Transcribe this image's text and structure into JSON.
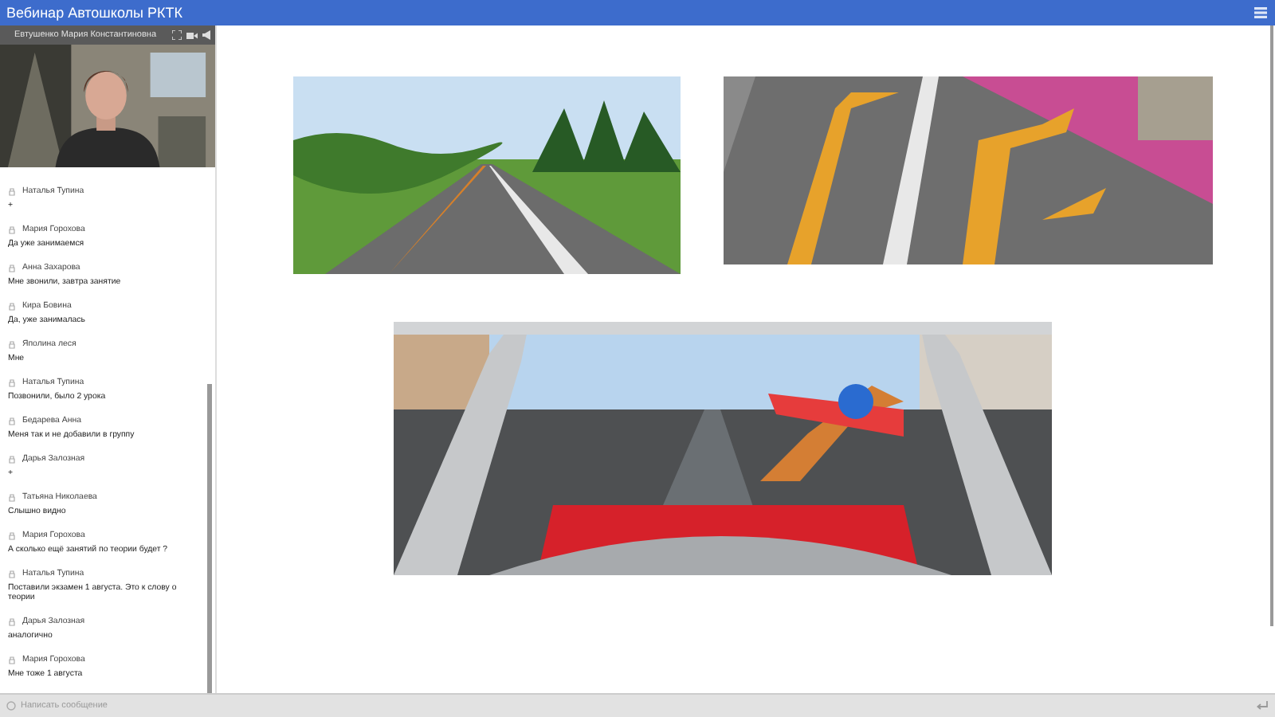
{
  "window": {
    "title": "Вебинар Автошколы РКТК"
  },
  "video": {
    "caption": "Евтушенко Мария Константиновна",
    "kind": "picture"
  },
  "chat": {
    "messages": [
      {
        "author": "Наталья Тупина",
        "text": "+"
      },
      {
        "author": "Мария Горохова",
        "text": "Да уже занимаемся"
      },
      {
        "author": "Анна Захарова",
        "text": "Мне звонили, завтра занятие"
      },
      {
        "author": "Кира Бовина",
        "text": "Да, уже занималась"
      },
      {
        "author": "Яполина леся",
        "text": "Мне"
      },
      {
        "author": "Наталья Тупина",
        "text": "Позвонили, было 2 урока"
      },
      {
        "author": "Бедарева Анна",
        "text": "Меня так и не добавили в группу"
      },
      {
        "author": "Дарья Залозная",
        "text": "+"
      },
      {
        "author": "Татьяна Николаева",
        "text": "Слышно видно"
      },
      {
        "author": "Мария Горохова",
        "text": "А сколько ещё занятий по теории будет ?"
      },
      {
        "author": "Наталья Тупина",
        "text": "Поставили экзамен 1 августа. Это к слову о теории"
      },
      {
        "author": "Дарья Залозная",
        "text": "аналогично"
      },
      {
        "author": "Мария Горохова",
        "text": "Мне тоже 1 августа"
      }
    ]
  },
  "message_input": {
    "placeholder": "Написать сообщение"
  }
}
